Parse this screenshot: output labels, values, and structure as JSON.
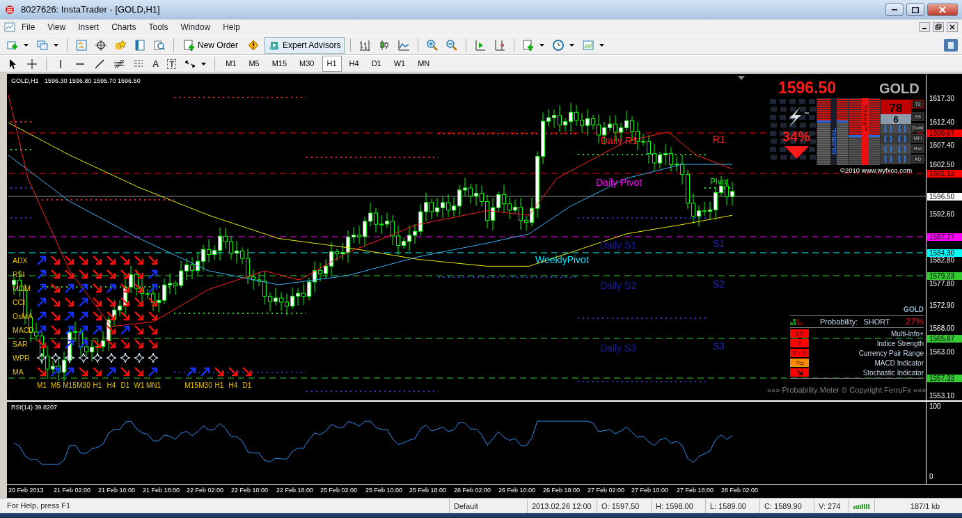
{
  "window": {
    "title": "8027626: InstaTrader - [GOLD,H1]"
  },
  "menu": [
    "File",
    "View",
    "Insert",
    "Charts",
    "Tools",
    "Window",
    "Help"
  ],
  "toolbar": {
    "buttons": [
      {
        "label": "New Order",
        "pressed": false
      },
      {
        "label": "Expert Advisors",
        "pressed": true
      }
    ]
  },
  "drawing_tools": {
    "text_tool": "A",
    "label_tool": "T"
  },
  "timeframes": [
    {
      "label": "M1",
      "selected": false
    },
    {
      "label": "M5",
      "selected": false
    },
    {
      "label": "M15",
      "selected": false
    },
    {
      "label": "M30",
      "selected": false
    },
    {
      "label": "H1",
      "selected": true
    },
    {
      "label": "H4",
      "selected": false
    },
    {
      "label": "D1",
      "selected": false
    },
    {
      "label": "W1",
      "selected": false
    },
    {
      "label": "MN",
      "selected": false
    }
  ],
  "chart": {
    "symbol": "GOLD,H1",
    "ohlc": "1596.30 1596.80 1595.70 1596.50",
    "level_labels": [
      {
        "text": "Daily R1",
        "color": "#ff2020"
      },
      {
        "text": "R1",
        "color": "#ff2020"
      },
      {
        "text": "Pivot",
        "color": "#00ff00"
      },
      {
        "text": "Daily Pivot",
        "color": "#ff00ff"
      },
      {
        "text": "Daily S1",
        "color": "#1c1ca0"
      },
      {
        "text": "S1",
        "color": "#2424c8"
      },
      {
        "text": "WeeklyPivot",
        "color": "#00e5ff"
      },
      {
        "text": "Daily S2",
        "color": "#1c1ca0"
      },
      {
        "text": "S2",
        "color": "#2424c8"
      },
      {
        "text": "Daily S3",
        "color": "#1c1ca0"
      },
      {
        "text": "S3",
        "color": "#2424c8"
      }
    ],
    "price_ticks": [
      "1617.30",
      "1612.40",
      "1607.40",
      "1602.50",
      "1592.60",
      "1582.80",
      "1577.80",
      "1572.90",
      "1568.00",
      "1563.00",
      "1553.10"
    ],
    "price_markers": [
      {
        "text": "1609.67",
        "color": "#ff0000"
      },
      {
        "text": "1601.13",
        "color": "#ff0000"
      },
      {
        "text": "1596.50",
        "color": "#ffffff"
      },
      {
        "text": "1587.77",
        "color": "#ff00ff"
      },
      {
        "text": "1584.30",
        "color": "#00ffff"
      },
      {
        "text": "1579.23",
        "color": "#32cd32"
      },
      {
        "text": "1565.87",
        "color": "#32cd32"
      },
      {
        "text": "1557.33",
        "color": "#32cd32"
      }
    ],
    "signal_matrix": {
      "columns": [
        "M1",
        "M5",
        "M15",
        "M30",
        "H1",
        "H4",
        "D1",
        "W1",
        "MN1"
      ],
      "rows": [
        {
          "label": "ADX",
          "kind": "arrows",
          "rising": [
            true,
            false,
            false,
            false,
            false,
            false,
            false,
            false,
            false
          ]
        },
        {
          "label": "RSI",
          "kind": "arrows",
          "rising": [
            true,
            false,
            false,
            false,
            false,
            false,
            false,
            false,
            true
          ]
        },
        {
          "label": "MOM",
          "kind": "arrows",
          "rising": [
            true,
            false,
            true,
            true,
            false,
            true,
            false,
            false,
            true
          ]
        },
        {
          "label": "CCI",
          "kind": "arrows",
          "rising": [
            true,
            false,
            false,
            true,
            false,
            false,
            false,
            false,
            false
          ]
        },
        {
          "label": "OsMA",
          "kind": "arrows",
          "rising": [
            true,
            false,
            true,
            true,
            false,
            false,
            false,
            false,
            false
          ]
        },
        {
          "label": "MACD",
          "kind": "arrows",
          "rising": [
            true,
            false,
            true,
            true,
            true,
            false,
            true,
            false,
            false
          ]
        },
        {
          "label": "SAR",
          "kind": "arrows",
          "rising": [
            false,
            false,
            true,
            true,
            false,
            false,
            false,
            false,
            false
          ]
        },
        {
          "label": "WPR",
          "kind": "stars"
        },
        {
          "label": "MA",
          "kind": "arrows",
          "rising": [
            false,
            true,
            true,
            false,
            false,
            true,
            false,
            false,
            true
          ]
        }
      ]
    },
    "signal_strip": {
      "columns": [
        "M15",
        "M30",
        "H1",
        "H4",
        "D1"
      ],
      "rising": [
        true,
        true,
        false,
        false,
        false
      ]
    },
    "widget": {
      "price": "1596.50",
      "symbol": "GOLD",
      "trademark": "™",
      "percent": "34%",
      "falling": true,
      "score": "78",
      "count": "6",
      "vertical_labels": [
        "GLOBAL",
        "TITAN II™"
      ],
      "tags": [
        "T2",
        "SS",
        "DoM",
        "MFI",
        "RVI",
        "AO"
      ],
      "copyright": "©2010 www.wyfxco.com"
    },
    "probability": {
      "symbol": "GOLD",
      "label": "Probability:",
      "direction": "SHORT",
      "percent": "27%",
      "rows": [
        {
          "kind": "text",
          "value": "69",
          "label": "Multi-Info+",
          "color": "#ff0000"
        },
        {
          "kind": "text",
          "value": "2",
          "label": "Indice Strength",
          "color": "#ff0000"
        },
        {
          "kind": "text",
          "value": "0 - 0",
          "label": "Currency Pair Range",
          "color": "#ff0000"
        },
        {
          "kind": "wave",
          "label": "MACD Indicator",
          "color": "#ff8c00"
        },
        {
          "kind": "arrow",
          "label": "Stochastic Indicator",
          "color": "#ff0000"
        }
      ],
      "footer": "»»» Probability Meter © Copyright FerruFx «««"
    }
  },
  "rsi": {
    "title": "RSI(14) 39.8207",
    "ticks": [
      "100",
      "0"
    ]
  },
  "time_labels": [
    "20 Feb 2013",
    "21 Feb 02:00",
    "21 Feb 10:00",
    "21 Feb 18:00",
    "22 Feb 02:00",
    "22 Feb 10:00",
    "22 Feb 18:00",
    "25 Feb 02:00",
    "25 Feb 10:00",
    "25 Feb 18:00",
    "26 Feb 02:00",
    "26 Feb 10:00",
    "26 Feb 18:00",
    "27 Feb 02:00",
    "27 Feb 10:00",
    "27 Feb 18:00",
    "28 Feb 02:00"
  ],
  "status_bar": {
    "help": "For Help, press F1",
    "profile": "Default",
    "fields": [
      "2013.02.26 12:00",
      "O: 1597.50",
      "H: 1598.00",
      "L: 1589.00",
      "C: 1589.90",
      "V: 274"
    ],
    "traffic": "187/1 kb"
  }
}
